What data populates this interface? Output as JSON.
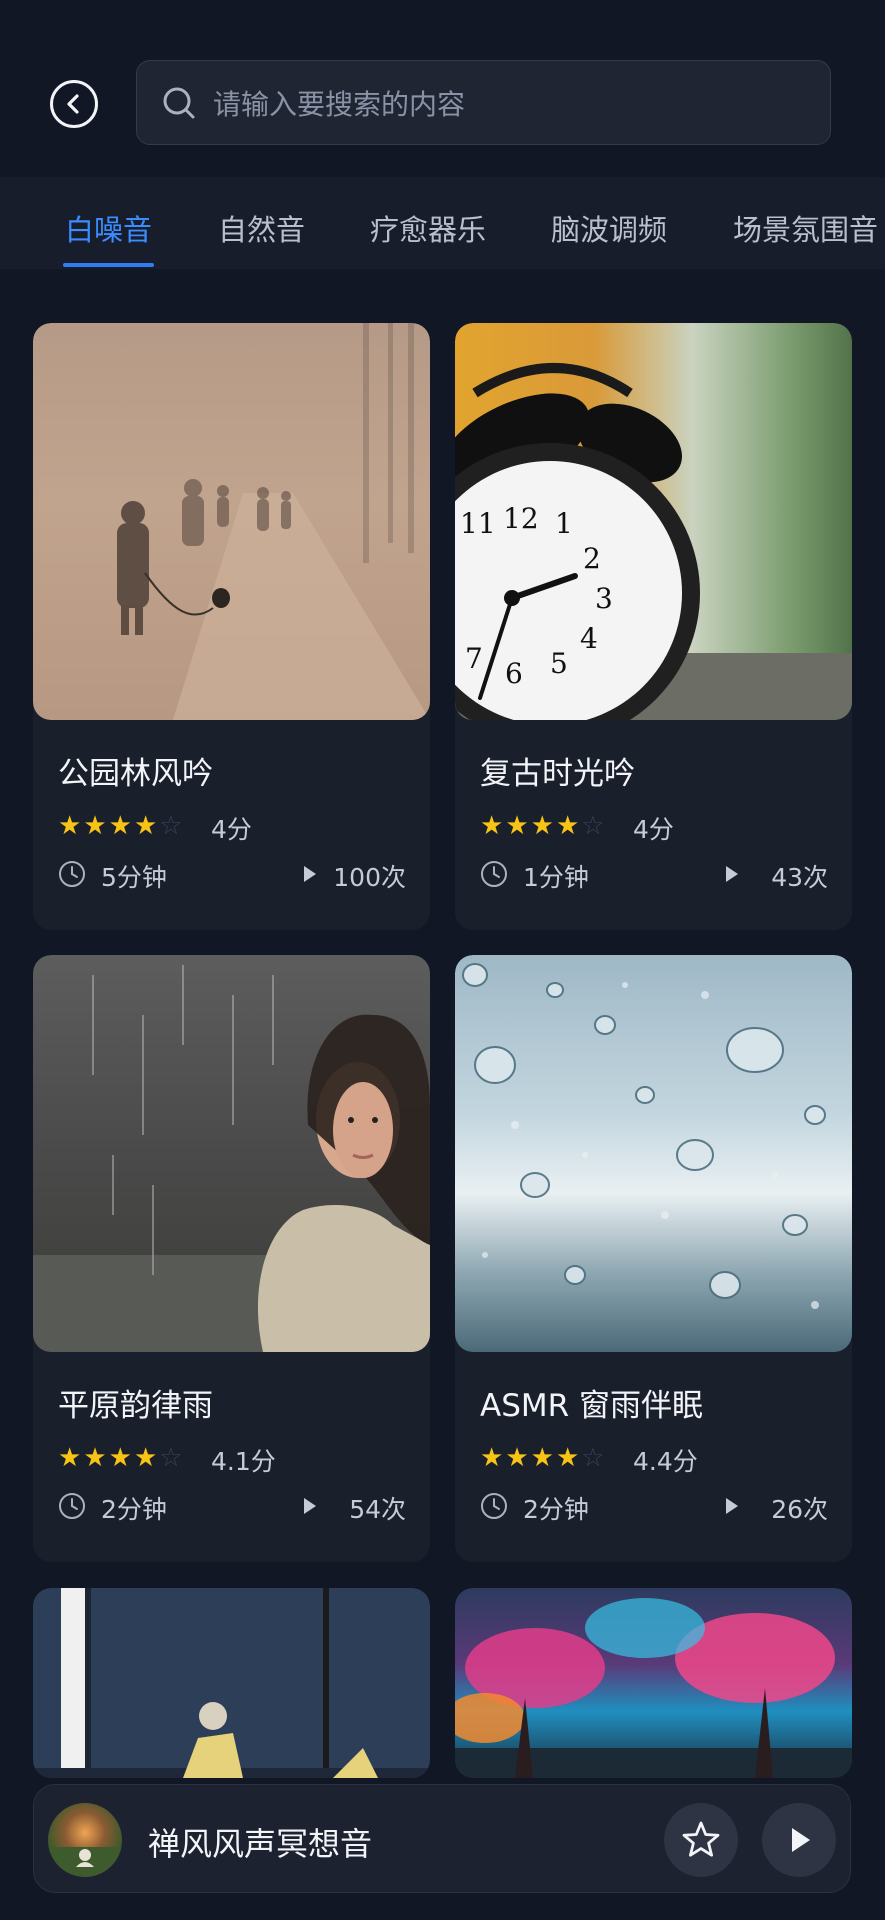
{
  "search": {
    "placeholder": "请输入要搜索的内容",
    "value": ""
  },
  "tabs": [
    {
      "label": "白噪音",
      "active": true
    },
    {
      "label": "自然音",
      "active": false
    },
    {
      "label": "疗愈器乐",
      "active": false
    },
    {
      "label": "脑波调频",
      "active": false
    },
    {
      "label": "场景氛围音",
      "active": false
    }
  ],
  "cards": [
    {
      "title": "公园林风吟",
      "rating": 4,
      "score": "4分",
      "duration": "5分钟",
      "plays": "100次"
    },
    {
      "title": "复古时光吟",
      "rating": 4,
      "score": "4分",
      "duration": "1分钟",
      "plays": "43次"
    },
    {
      "title": "平原韵律雨",
      "rating": 4,
      "score": "4.1分",
      "duration": "2分钟",
      "plays": "54次"
    },
    {
      "title": "ASMR 窗雨伴眠",
      "rating": 4,
      "score": "4.4分",
      "duration": "2分钟",
      "plays": "26次"
    }
  ],
  "player": {
    "title": "禅风风声冥想音"
  },
  "colors": {
    "accent": "#2f7df2",
    "star": "#f7c315",
    "background": "#111724",
    "card": "#1a1f2c"
  }
}
